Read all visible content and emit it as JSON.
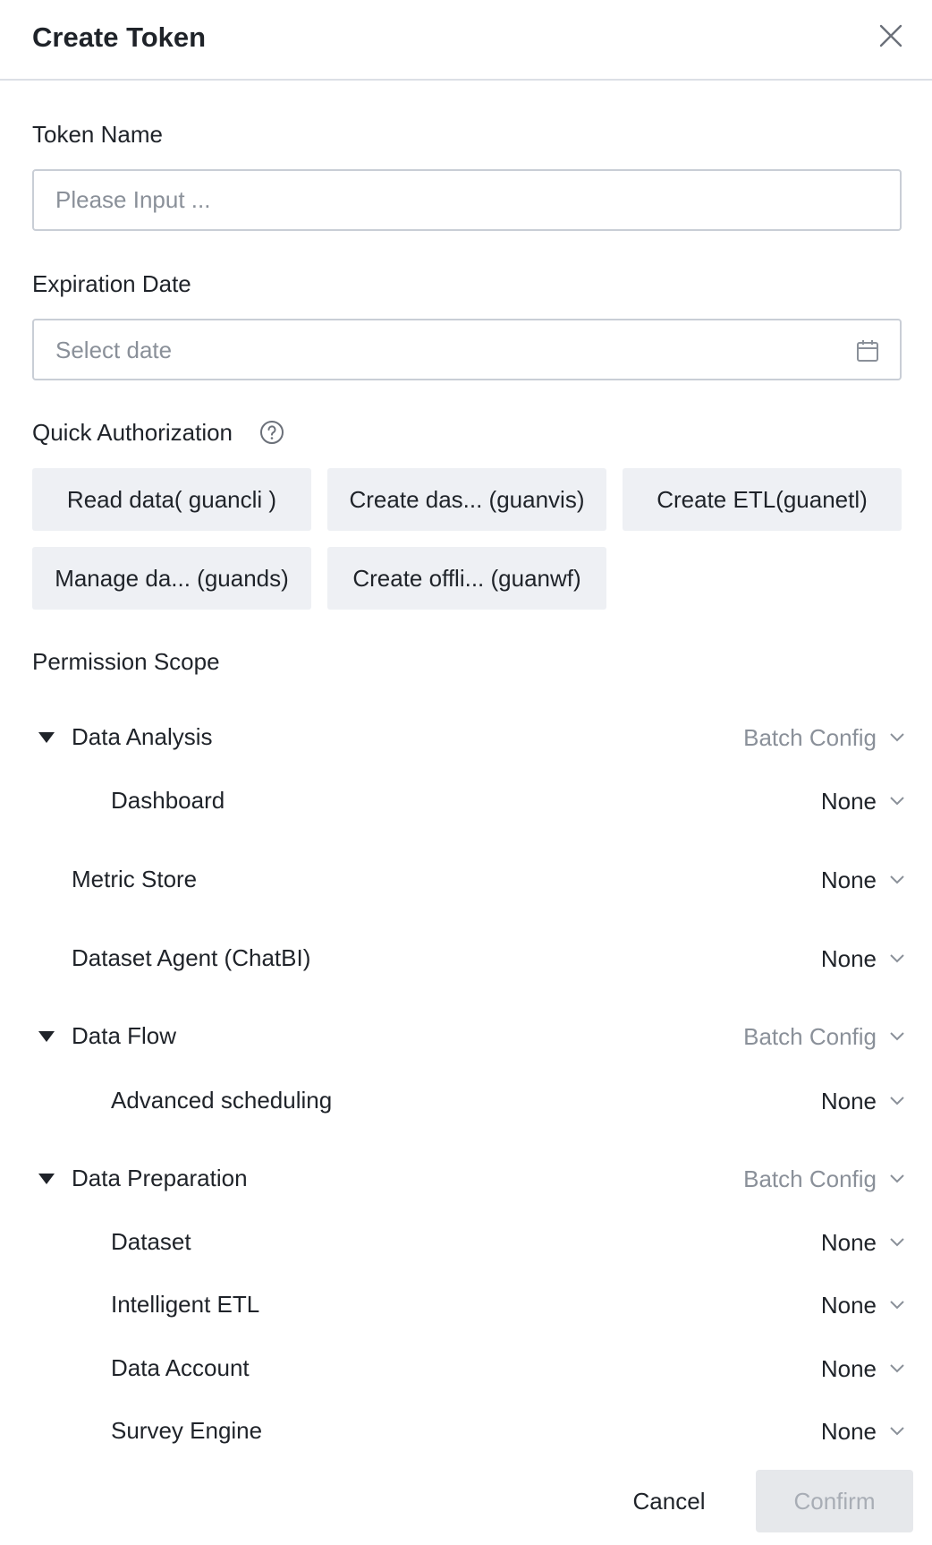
{
  "dialog": {
    "title": "Create Token",
    "close_icon": "close-icon"
  },
  "token_name": {
    "label": "Token Name",
    "placeholder": "Please Input ...",
    "value": ""
  },
  "expiration": {
    "label": "Expiration Date",
    "placeholder": "Select date",
    "icon": "calendar-icon"
  },
  "quick_auth": {
    "label": "Quick Authorization",
    "help_icon": "question-circle-icon",
    "chips": [
      "Read data( guancli )",
      "Create das... (guanvis)",
      "Create ETL(guanetl)",
      "Manage da... (guands)",
      "Create offli... (guanwf)"
    ]
  },
  "permission_scope": {
    "label": "Permission Scope",
    "rows": [
      {
        "label": "Data Analysis",
        "value": "Batch Config"
      },
      {
        "label": "Dashboard",
        "value": "None"
      },
      {
        "label": "Metric Store",
        "value": "None"
      },
      {
        "label": "Dataset Agent (ChatBI)",
        "value": "None"
      },
      {
        "label": "Data Flow",
        "value": "Batch Config"
      },
      {
        "label": "Advanced scheduling",
        "value": "None"
      },
      {
        "label": "Data Preparation",
        "value": "Batch Config"
      },
      {
        "label": "Dataset",
        "value": "None"
      },
      {
        "label": "Intelligent ETL",
        "value": "None"
      },
      {
        "label": "Data Account",
        "value": "None"
      },
      {
        "label": "Survey Engine",
        "value": "None"
      }
    ]
  },
  "footer": {
    "cancel_label": "Cancel",
    "confirm_label": "Confirm"
  },
  "colors": {
    "text": "#1f2329",
    "placeholder": "#8a9099",
    "chip_bg": "#eef0f4",
    "border": "#c9ced6",
    "disabled_bg": "#e6e8eb",
    "disabled_text": "#a8adb5"
  }
}
